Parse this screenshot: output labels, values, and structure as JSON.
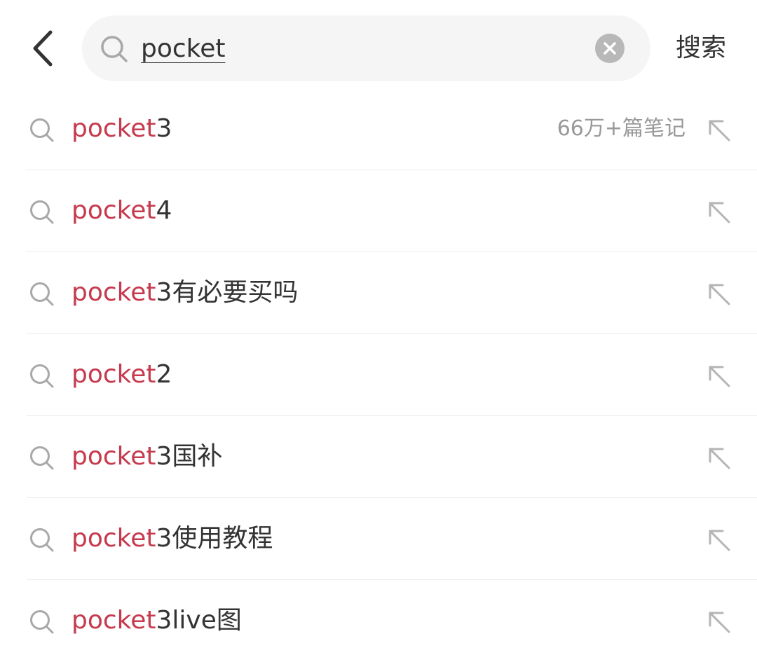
{
  "header": {
    "search_value": "pocket",
    "search_button_label": "搜索"
  },
  "suggestions": [
    {
      "highlight": "pocket",
      "rest": "3",
      "count": "66万+篇笔记"
    },
    {
      "highlight": "pocket",
      "rest": "4"
    },
    {
      "highlight": "pocket",
      "rest": "3有必要买吗"
    },
    {
      "highlight": "pocket",
      "rest": "2"
    },
    {
      "highlight": "pocket",
      "rest": "3国补"
    },
    {
      "highlight": "pocket",
      "rest": "3使用教程"
    },
    {
      "highlight": "pocket",
      "rest": "3live图"
    }
  ],
  "icons": {
    "back": "chevron-left-icon",
    "search": "magnifier-icon",
    "clear": "clear-x-icon",
    "fill": "arrow-up-left-icon"
  },
  "colors": {
    "highlight": "#c63a4e",
    "text": "#333333",
    "muted": "#999999",
    "search_bg": "#f5f5f5"
  }
}
